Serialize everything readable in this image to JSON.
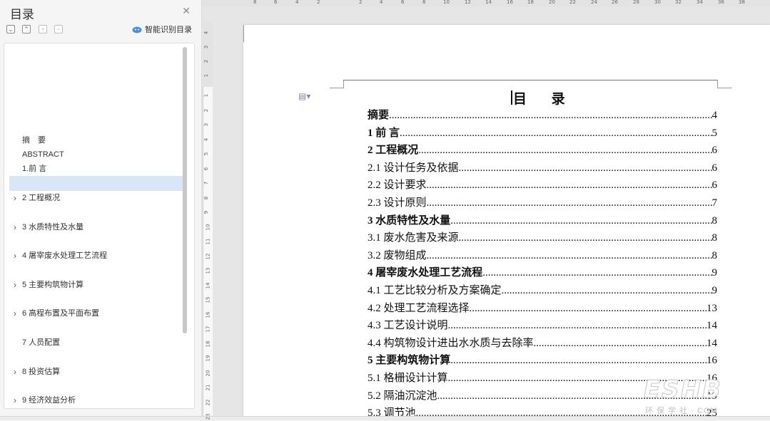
{
  "toc_panel": {
    "title": "目录",
    "close_icon": "close-icon",
    "smart_toc_label": "智能识别目录",
    "toolbar_icons": [
      "collapse-all-icon",
      "expand-all-icon",
      "add-level-icon",
      "remove-level-icon"
    ],
    "items": [
      {
        "label": "摘　要",
        "chevron": false
      },
      {
        "label": "ABSTRACT",
        "chevron": false
      },
      {
        "label": "1.前 言",
        "chevron": false
      },
      {
        "label": "",
        "chevron": false,
        "selected": true
      },
      {
        "label": "2 工程概况",
        "chevron": true
      },
      {
        "label": "3 水质特性及水量",
        "chevron": true
      },
      {
        "label": "4 屠宰废水处理工艺流程",
        "chevron": true
      },
      {
        "label": "5 主要构筑物计算",
        "chevron": true
      },
      {
        "label": "6 高程布置及平面布置",
        "chevron": true
      },
      {
        "label": "7 人员配置",
        "chevron": false
      },
      {
        "label": "8 投资估算",
        "chevron": true
      },
      {
        "label": "9 经济效益分析",
        "chevron": true
      }
    ],
    "selected_color": "#d8e6f7"
  },
  "ruler": {
    "horizontal_numbers": [
      "8",
      "6",
      "4",
      "2",
      "2",
      "4",
      "6",
      "8",
      "10",
      "12",
      "14",
      "16",
      "18",
      "20",
      "22",
      "24",
      "26",
      "28",
      "30",
      "32",
      "34",
      "36",
      "38"
    ],
    "vertical_numbers": [
      "4",
      "3",
      "2",
      "1",
      "1",
      "2",
      "3",
      "4",
      "5",
      "6",
      "7",
      "8",
      "9",
      "10",
      "11",
      "12",
      "13",
      "14",
      "15",
      "16",
      "17",
      "18",
      "19",
      "20",
      "21",
      "22",
      "23"
    ]
  },
  "document": {
    "heading": "目 录",
    "entries": [
      {
        "text": "摘要",
        "page": "4",
        "bold": true
      },
      {
        "text": "1  前  言",
        "page": "5",
        "bold": true
      },
      {
        "text": "2  工程概况",
        "page": "6",
        "bold": true
      },
      {
        "text": "2.1 设计任务及依据",
        "page": "6",
        "bold": false
      },
      {
        "text": "2.2 设计要求",
        "page": "6",
        "bold": false
      },
      {
        "text": "2.3 设计原则",
        "page": "7",
        "bold": false
      },
      {
        "text": "3  水质特性及水量",
        "page": "8",
        "bold": true
      },
      {
        "text": "3.1 废水危害及来源",
        "page": "8",
        "bold": false
      },
      {
        "text": "3.2 废物组成",
        "page": "8",
        "bold": false
      },
      {
        "text": "4  屠宰废水处理工艺流程",
        "page": "9",
        "bold": true
      },
      {
        "text": "4.1 工艺比较分析及方案确定",
        "page": "9",
        "bold": false
      },
      {
        "text": "4.2 处理工艺流程选择",
        "page": "13",
        "bold": false
      },
      {
        "text": "4.3 工艺设计说明",
        "page": "14",
        "bold": false
      },
      {
        "text": "4.4  构筑物设计进出水水质与去除率",
        "page": "14",
        "bold": false
      },
      {
        "text": "5  主要构筑物计算",
        "page": "16",
        "bold": true
      },
      {
        "text": "5.1 格栅设计计算",
        "page": "16",
        "bold": false
      },
      {
        "text": "5.2  隔油沉淀池",
        "page": "19",
        "bold": false
      },
      {
        "text": "5.3  调节池",
        "page": "25",
        "bold": false
      }
    ]
  },
  "watermark": {
    "big": "ESHB",
    "small": "环 保 学 社 · COM"
  }
}
